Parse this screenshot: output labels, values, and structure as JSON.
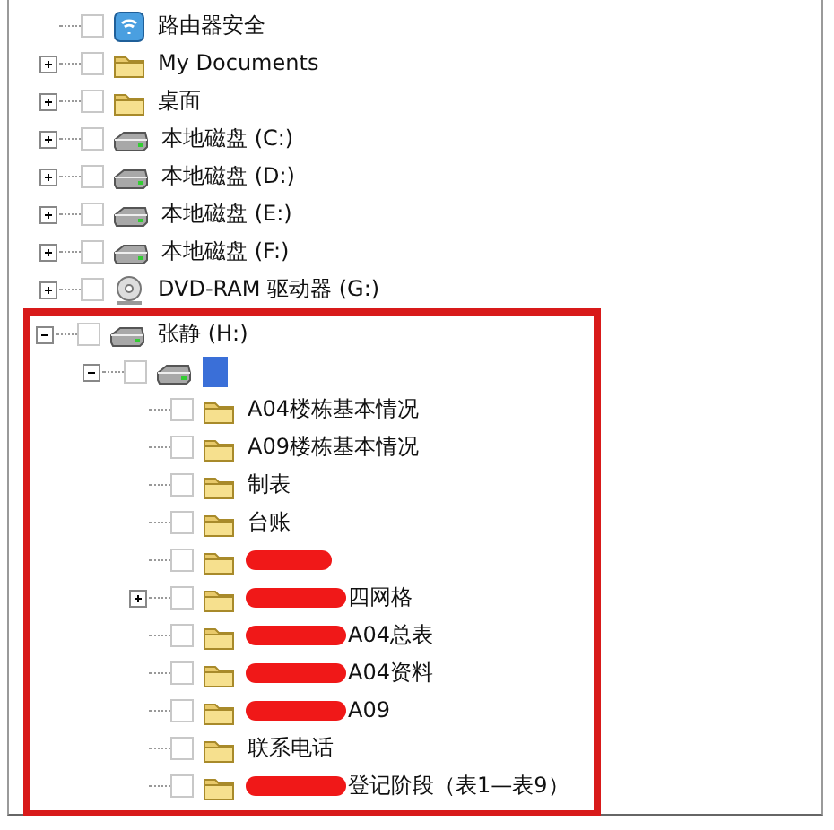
{
  "tree": [
    {
      "label": "路由器安全",
      "kind": "shield",
      "checked": false,
      "selected": false
    },
    {
      "label": "My Documents",
      "kind": "folder",
      "checked": false,
      "selected": false,
      "expanded": false
    },
    {
      "label": "桌面",
      "kind": "folder",
      "checked": false,
      "selected": false,
      "expanded": false
    },
    {
      "label": "本地磁盘 (C:)",
      "kind": "disk",
      "checked": false,
      "selected": false,
      "expanded": false
    },
    {
      "label": "本地磁盘 (D:)",
      "kind": "disk",
      "checked": false,
      "selected": false,
      "expanded": false
    },
    {
      "label": "本地磁盘 (E:)",
      "kind": "disk",
      "checked": false,
      "selected": false,
      "expanded": false
    },
    {
      "label": "本地磁盘 (F:)",
      "kind": "disk",
      "checked": false,
      "selected": false,
      "expanded": false
    },
    {
      "label": "DVD-RAM 驱动器 (G:)",
      "kind": "dvd",
      "checked": false,
      "selected": false,
      "expanded": false
    },
    {
      "label": "张静 (H:)",
      "kind": "disk",
      "checked": false,
      "selected": false,
      "expanded": true,
      "highlighted": true,
      "children": [
        {
          "kind": "disk",
          "checked": false,
          "selected": true,
          "expanded": true,
          "children": [
            {
              "label": "A04楼栋基本情况",
              "kind": "folder",
              "checked": false,
              "selected": false
            },
            {
              "label": "A09楼栋基本情况",
              "kind": "folder",
              "checked": false,
              "selected": false
            },
            {
              "label": "制表",
              "kind": "folder",
              "checked": false,
              "selected": false
            },
            {
              "label": "台账",
              "kind": "folder",
              "checked": false,
              "selected": false
            },
            {
              "kind": "folder",
              "checked": false,
              "selected": false,
              "redacted": true
            },
            {
              "label": "四网格",
              "kind": "folder",
              "checked": false,
              "selected": false,
              "expanded": false,
              "redacted": true
            },
            {
              "label": "A04总表",
              "kind": "folder",
              "checked": false,
              "selected": false,
              "redacted": true
            },
            {
              "label": "A04资料",
              "kind": "folder",
              "checked": false,
              "selected": false,
              "redacted": true
            },
            {
              "label": "A09",
              "kind": "folder",
              "checked": false,
              "selected": false,
              "redacted": true
            },
            {
              "label": "联系电话",
              "kind": "folder",
              "checked": false,
              "selected": false
            },
            {
              "label": "登记阶段（表1—表9）",
              "kind": "folder",
              "checked": false,
              "selected": false,
              "redacted": true
            }
          ]
        }
      ]
    }
  ]
}
